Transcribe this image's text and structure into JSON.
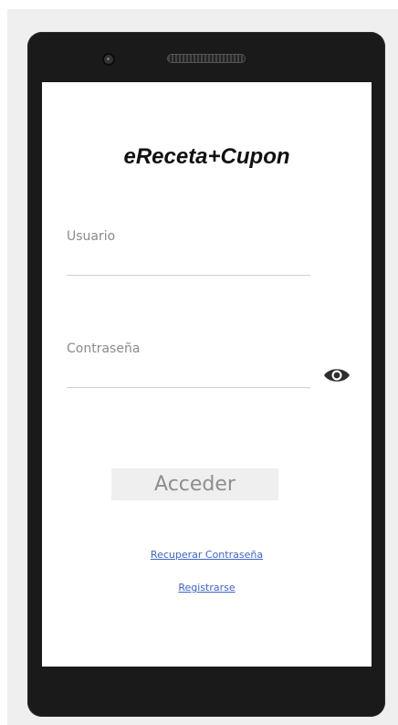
{
  "app": {
    "title": "eReceta+Cupon"
  },
  "form": {
    "username_label": "Usuario",
    "username_value": "",
    "password_label": "Contraseña",
    "password_value": "",
    "show_password_icon": "eye-icon",
    "submit_label": "Acceder"
  },
  "links": {
    "recover_password": "Recuperar Contraseña",
    "register": "Registrarse"
  },
  "colors": {
    "link": "#3b64cc",
    "button_bg": "#efefef",
    "label": "#8a8a8a"
  }
}
